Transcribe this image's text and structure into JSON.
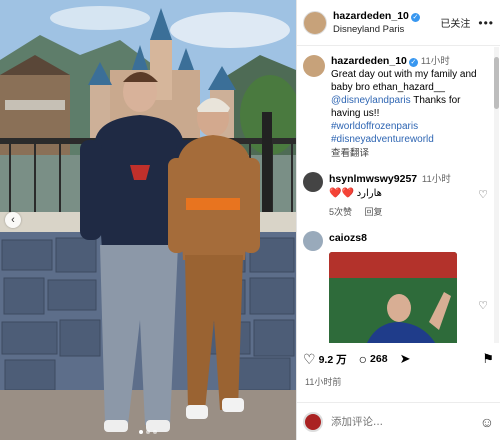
{
  "post": {
    "username": "hazardeden_10",
    "location": "Disneyland Paris",
    "follow_label": "已关注",
    "more_label": "•••",
    "caption": {
      "username": "hazardeden_10",
      "time": "11小时",
      "text": "Great day out with my family and baby bro ethan_hazard__",
      "mention": "@disneylandparis",
      "text2": "Thanks for having us!!",
      "hashtags": "#worldoffrozenparis #disneyadventureworld",
      "translate": "查看翻译"
    },
    "comments": [
      {
        "username": "hsynlmwswy9257",
        "time": "11小时",
        "text": "هارارد",
        "hearts": "❤️❤️",
        "likes": "5次赞",
        "reply": "回复"
      },
      {
        "username": "caiozs8",
        "time": "",
        "text": ""
      }
    ],
    "likes": "9.2 万",
    "comments_count": "268",
    "posted": "11小时前",
    "add_comment_placeholder": "添加评论..."
  }
}
